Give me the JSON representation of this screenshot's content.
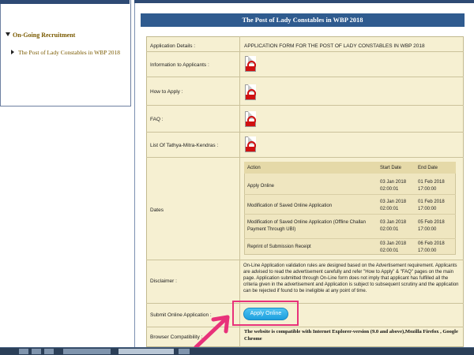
{
  "sidebar": {
    "heading": "On-Going Recruitment",
    "item": "The Post of Lady Constables in WBP 2018"
  },
  "page": {
    "title": "The Post of Lady Constables in WBP 2018"
  },
  "rows": {
    "application_details": {
      "label": "Application Details :",
      "value": "APPLICATION FORM FOR THE POST OF LADY CONSTABLES IN WBP 2018"
    },
    "information": {
      "label": "Information to Applicants :",
      "icon": "pdf-icon"
    },
    "how_to_apply": {
      "label": "How to Apply :",
      "icon": "pdf-icon"
    },
    "faq": {
      "label": "FAQ :",
      "icon": "pdf-icon"
    },
    "tathya": {
      "label": "List Of Tathya-Mitra-Kendras :",
      "icon": "pdf-icon"
    },
    "dates": {
      "label": "Dates"
    },
    "disclaimer": {
      "label": "Disclaimer :",
      "text": "On-Line Application validation rules are designed based on the Advertisement requirement. Applicants are advised to read the advertisement carefully and refer \"How to Apply\" & \"FAQ\" pages on the main page. Application submitted through On-Line form does not imply that applicant has fulfilled all the criteria given in the advertisement and Application is subject to subsequent scrutiny and the application can be rejected if found to be ineligible at any point of time."
    },
    "submit": {
      "label": "Submit Online Application :",
      "button": "Apply Online"
    },
    "browser": {
      "label": "Browser Compatibility :",
      "text": "The website is compatible with Internet Explorer-version (9.0 and above),Mozilla Firefox , Google Chrome"
    }
  },
  "dates_table": {
    "headers": {
      "action": "Action",
      "start": "Start Date",
      "end": "End Date"
    },
    "rows": [
      {
        "action": "Apply Online",
        "start_d": "03 Jan 2018",
        "start_t": "02:00:01",
        "end_d": "01 Feb 2018",
        "end_t": "17:00:00"
      },
      {
        "action": "Modification of Saved Online Application",
        "start_d": "03 Jan 2018",
        "start_t": "02:00:01",
        "end_d": "01 Feb 2018",
        "end_t": "17:00:00"
      },
      {
        "action_1": "Modification of Saved Online Application (Offline Challan",
        "action_2": "Payment Through UBI)",
        "start_d": "03 Jan 2018",
        "start_t": "02:00:01",
        "end_d": "05 Feb 2018",
        "end_t": "17:00:00"
      },
      {
        "action": "Reprint of Submission Receipt",
        "start_d": "03 Jan 2018",
        "start_t": "02:00:01",
        "end_d": "06 Feb 2018",
        "end_t": "17:00:00"
      }
    ]
  },
  "colors": {
    "title_bar": "#2f5b8f",
    "grid_bg": "#f6f0d2",
    "button": "#1e9fde",
    "highlight": "#e8327a"
  }
}
